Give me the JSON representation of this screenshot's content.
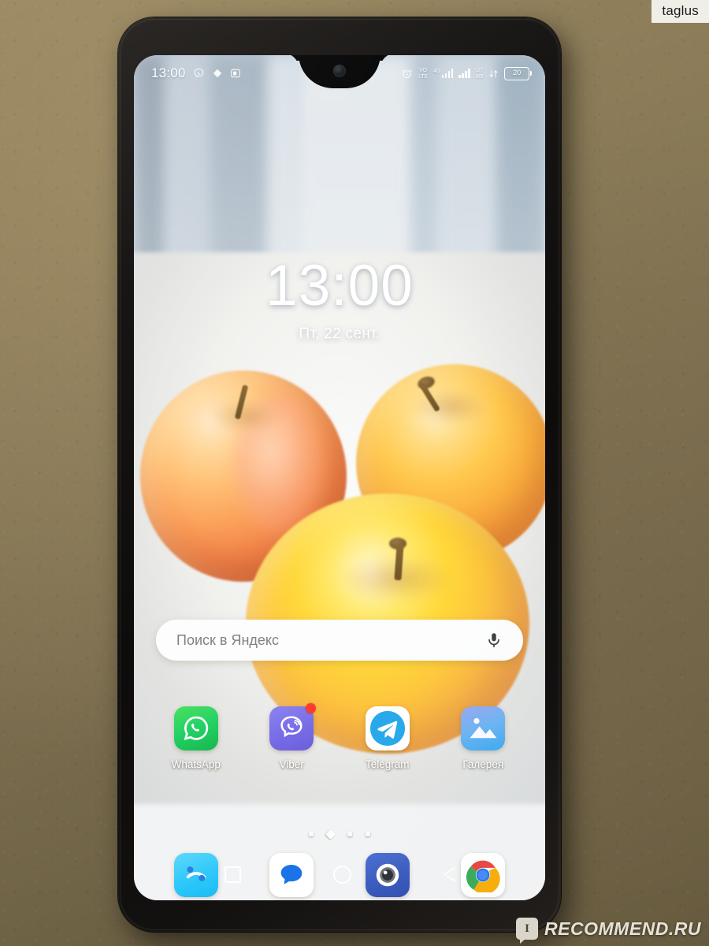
{
  "watermarks": {
    "top_right": "taglus",
    "bottom_right": "RECOMMEND.RU",
    "bottom_logo_letter": "I"
  },
  "device": {
    "type": "android-smartphone",
    "notch_style": "waterdrop",
    "bezel_color": "#141211"
  },
  "status_bar": {
    "clock": "13:00",
    "left_icons": [
      {
        "name": "viber-status-icon",
        "glyph": "viber"
      },
      {
        "name": "diamond-status-icon",
        "glyph": "diamond"
      },
      {
        "name": "app-status-icon",
        "glyph": "app"
      }
    ],
    "right_icons": [
      {
        "name": "alarm-icon",
        "glyph": "alarm"
      },
      {
        "name": "volte-icon",
        "label_top": "VO",
        "label_bottom": "LTE"
      },
      {
        "name": "signal-sim1-icon",
        "label": "4G"
      },
      {
        "name": "signal-sim2-icon",
        "label": ""
      },
      {
        "name": "data-transfer-icon",
        "label_top": "1/7",
        "label_bottom": "8/9"
      },
      {
        "name": "dual-arrow-icon",
        "label": "46"
      }
    ],
    "battery": {
      "level_text": "20",
      "name": "battery-icon"
    }
  },
  "clock_widget": {
    "time": "13:00",
    "date": "Пт, 22 сент."
  },
  "search": {
    "placeholder": "Поиск в Яндекс",
    "mic_icon": "microphone-icon"
  },
  "app_grid": [
    {
      "label": "WhatsApp",
      "icon": "whatsapp-icon",
      "badge": false,
      "color": "#25d366"
    },
    {
      "label": "Viber",
      "icon": "viber-icon",
      "badge": true,
      "color": "#7a6fe8"
    },
    {
      "label": "Telegram",
      "icon": "telegram-icon",
      "badge": false,
      "color": "#2aabee"
    },
    {
      "label": "Галерея",
      "icon": "gallery-icon",
      "badge": false,
      "color": "#3aa7ef"
    }
  ],
  "page_indicator": {
    "total": 4,
    "active_index": 1
  },
  "dock": [
    {
      "name": "phone-icon",
      "label": "Phone",
      "color": "#31c9fa"
    },
    {
      "name": "messages-icon",
      "label": "Messages",
      "color": "#2f7ef0"
    },
    {
      "name": "camera-icon",
      "label": "Camera",
      "color": "#3a5cc0"
    },
    {
      "name": "chrome-icon",
      "label": "Chrome",
      "color": "#ffffff"
    }
  ],
  "nav_bar": [
    {
      "name": "nav-recents-button",
      "label": "Recents",
      "glyph": "square"
    },
    {
      "name": "nav-home-button",
      "label": "Home",
      "glyph": "circle"
    },
    {
      "name": "nav-back-button",
      "label": "Back",
      "glyph": "triangle"
    }
  ],
  "wallpaper": {
    "subject": "three yellow-orange apples on a white surface",
    "colors": [
      "#fdcb45",
      "#f7b543",
      "#f08a4c",
      "#eef1f4",
      "#b9c8d6"
    ]
  },
  "background": {
    "description": "textured tan plaster wall",
    "color": "#8b7b58"
  }
}
